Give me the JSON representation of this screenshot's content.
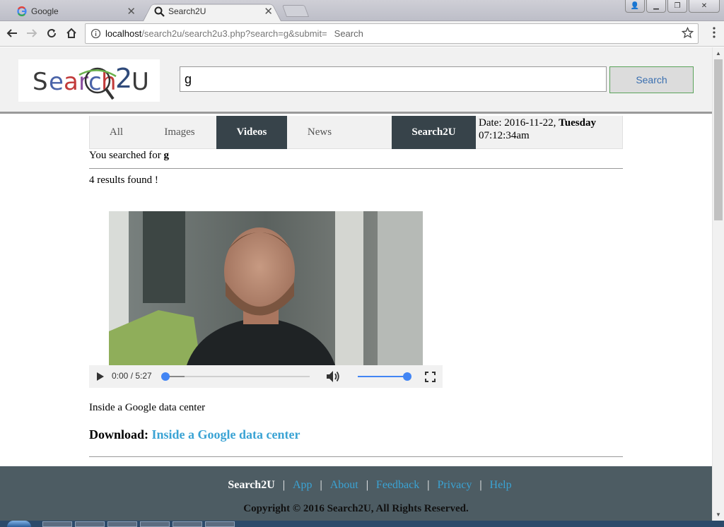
{
  "browser": {
    "tabs": [
      {
        "title": "Google",
        "icon": "google-g-icon",
        "active": false
      },
      {
        "title": "Search2U",
        "icon": "search-icon",
        "active": true
      }
    ],
    "address": {
      "host": "localhost",
      "path": "/search2u/search2u3.php?search=g&submit=",
      "suffix": "Search"
    }
  },
  "page": {
    "logo_alt": "Search2U",
    "search_value": "g",
    "search_button": "Search",
    "nav_tabs": [
      "All",
      "Images",
      "Videos",
      "News"
    ],
    "active_tab": "Videos",
    "brand_tab": "Search2U",
    "date_label": "Date: 2016-11-22,",
    "date_day": "Tuesday",
    "date_time": "07:12:34am",
    "searched_prefix": "You searched for",
    "searched_term": "g",
    "results_count": "4 results found !",
    "video": {
      "current_time": "0:00",
      "duration": "5:27",
      "progress_fraction": 0,
      "buffered_fraction": 0.13,
      "volume_fraction": 1.0,
      "caption": "Inside a Google data center"
    },
    "download_label": "Download:",
    "download_link": "Inside a Google data center",
    "footer": {
      "brand": "Search2U",
      "links": [
        "App",
        "About",
        "Feedback",
        "Privacy",
        "Help"
      ],
      "copyright": "Copyright © 2016 Search2U, All Rights Reserved."
    }
  },
  "colors": {
    "nav_active_bg": "#37434a",
    "link": "#3aa3d4",
    "footer_bg": "#4d5c63",
    "media_accent": "#4285f4"
  }
}
